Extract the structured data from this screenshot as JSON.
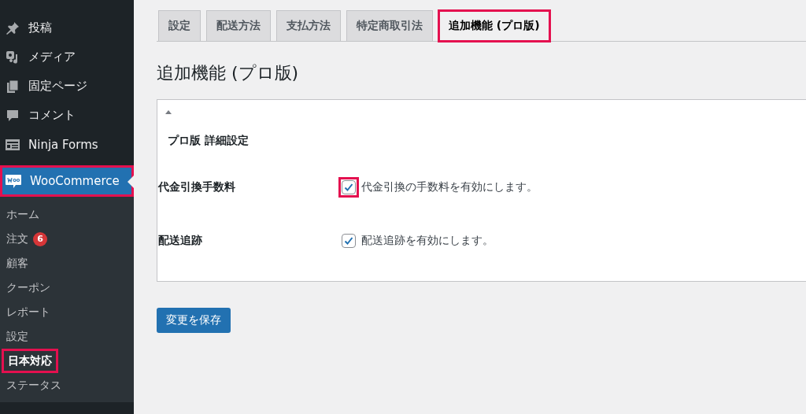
{
  "sidebar": {
    "items": [
      {
        "label": "投稿",
        "kind": "pin"
      },
      {
        "label": "メディア",
        "kind": "media"
      },
      {
        "label": "固定ページ",
        "kind": "pages"
      },
      {
        "label": "コメント",
        "kind": "comment"
      },
      {
        "label": "Ninja Forms",
        "kind": "form"
      },
      {
        "label": "WooCommerce",
        "kind": "woo",
        "selected": true,
        "highlighted": true
      }
    ],
    "submenu": [
      {
        "label": "ホーム",
        "selected": false,
        "highlighted": false
      },
      {
        "label": "注文",
        "badge": "6",
        "selected": false,
        "highlighted": false
      },
      {
        "label": "顧客",
        "selected": false,
        "highlighted": false
      },
      {
        "label": "クーポン",
        "selected": false,
        "highlighted": false
      },
      {
        "label": "レポート",
        "selected": false,
        "highlighted": false
      },
      {
        "label": "設定",
        "selected": false,
        "highlighted": false
      },
      {
        "label": "日本対応",
        "selected": true,
        "highlighted": true
      },
      {
        "label": "ステータス",
        "selected": false,
        "highlighted": false
      }
    ]
  },
  "tabs": [
    {
      "label": "設定",
      "selected": false,
      "highlighted": false
    },
    {
      "label": "配送方法",
      "selected": false,
      "highlighted": false
    },
    {
      "label": "支払方法",
      "selected": false,
      "highlighted": false
    },
    {
      "label": "特定商取引法",
      "selected": false,
      "highlighted": false
    },
    {
      "label": "追加機能 (プロ版)",
      "selected": true,
      "highlighted": true
    }
  ],
  "page_title": "追加機能 (プロ版)",
  "panel": {
    "expanded": true,
    "title": "プロ版 詳細設定",
    "rows": [
      {
        "label": "代金引換手数料",
        "checked": true,
        "text": "代金引換の手数料を有効にします。",
        "highlighted": true
      },
      {
        "label": "配送追跡",
        "checked": true,
        "text": "配送追跡を有効にします。",
        "highlighted": false
      }
    ]
  },
  "save_button": "変更を保存"
}
